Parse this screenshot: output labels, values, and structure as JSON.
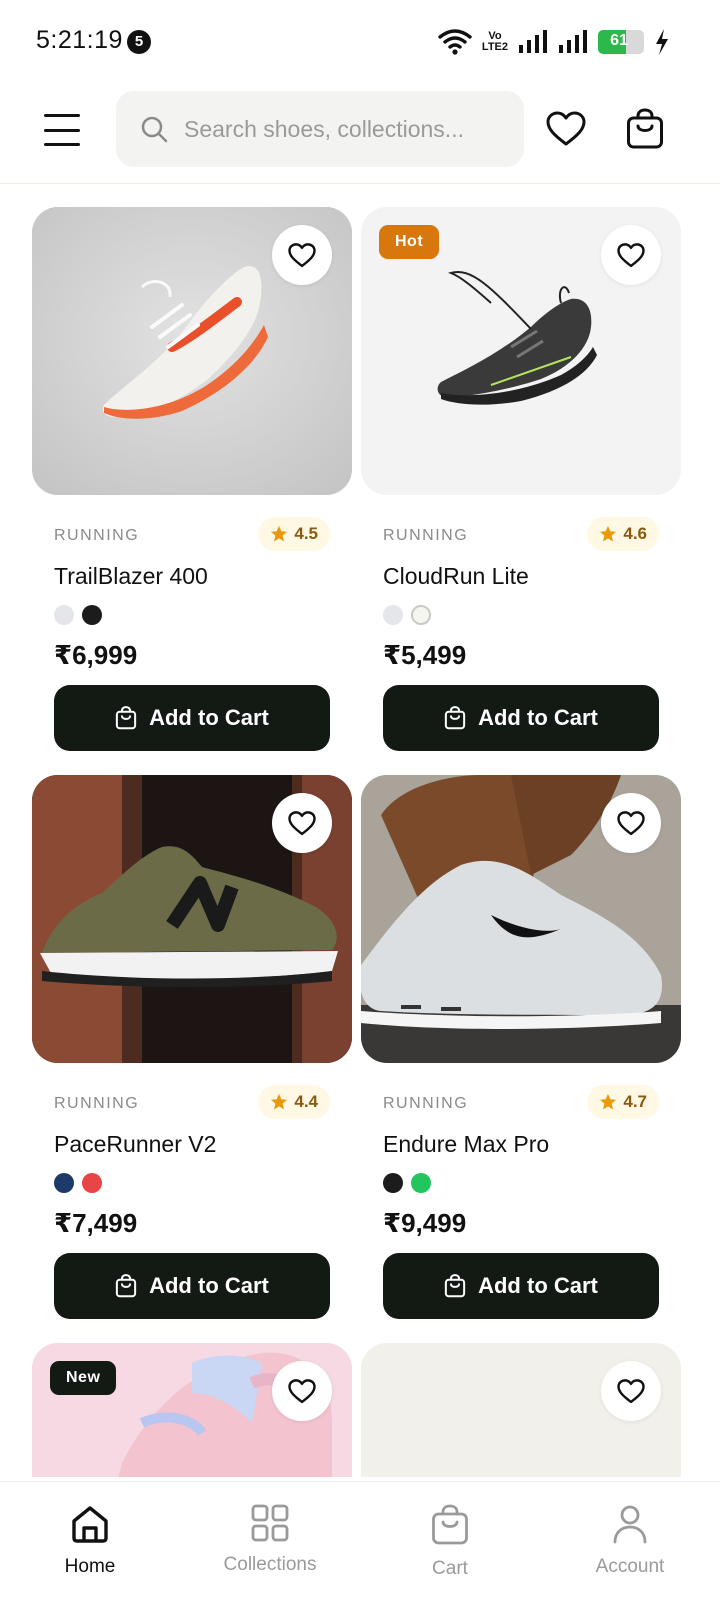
{
  "status_bar": {
    "time": "5:21:19",
    "notification_count": "5",
    "network_label_top": "Vo",
    "network_label_bottom": "LTE2",
    "battery_level": "61",
    "charging": true
  },
  "header": {
    "search_placeholder": "Search shoes, collections..."
  },
  "products": [
    {
      "category": "RUNNING",
      "rating": "4.5",
      "name": "TrailBlazer 400",
      "price": "₹6,999",
      "colors": [
        "#e4e6ea",
        "#1c1c1c"
      ],
      "tag": "",
      "add_label": "Add to Cart",
      "image": "sneaker-white-orange",
      "image_bg": "#cfcfcf"
    },
    {
      "category": "RUNNING",
      "rating": "4.6",
      "name": "CloudRun Lite",
      "price": "₹5,499",
      "colors": [
        "#e4e6ea",
        "#f5f5f0"
      ],
      "tag": "Hot",
      "tag_color": "#d9770f",
      "add_label": "Add to Cart",
      "image": "sneaker-black",
      "image_bg": "#f4f4f4"
    },
    {
      "category": "RUNNING",
      "rating": "4.4",
      "name": "PaceRunner V2",
      "price": "₹7,499",
      "colors": [
        "#1e3a6b",
        "#e84646"
      ],
      "tag": "",
      "add_label": "Add to Cart",
      "image": "sneaker-olive",
      "image_bg": "#5a3326"
    },
    {
      "category": "RUNNING",
      "rating": "4.7",
      "name": "Endure Max Pro",
      "price": "₹9,499",
      "colors": [
        "#1c1c1c",
        "#22c55e"
      ],
      "tag": "",
      "add_label": "Add to Cart",
      "image": "sneaker-grey",
      "image_bg": "#b9b2a8"
    },
    {
      "category": "",
      "rating": "",
      "name": "",
      "price": "",
      "colors": [],
      "tag": "New",
      "tag_color": "#121a13",
      "add_label": "",
      "image": "sneaker-pastel",
      "image_bg": "#f5d6df"
    },
    {
      "category": "",
      "rating": "",
      "name": "",
      "price": "",
      "colors": [],
      "tag": "",
      "add_label": "",
      "image": "placeholder",
      "image_bg": "#f1f0ea"
    }
  ],
  "bottom_nav": [
    {
      "label": "Home",
      "icon": "home-icon",
      "active": true
    },
    {
      "label": "Collections",
      "icon": "grid-icon",
      "active": false
    },
    {
      "label": "Cart",
      "icon": "bag-icon",
      "active": false
    },
    {
      "label": "Account",
      "icon": "user-icon",
      "active": false
    }
  ],
  "colors": {
    "accent": "#121a13",
    "hot_tag": "#d9770f",
    "star": "#e89a0c",
    "battery": "#2db84b"
  }
}
